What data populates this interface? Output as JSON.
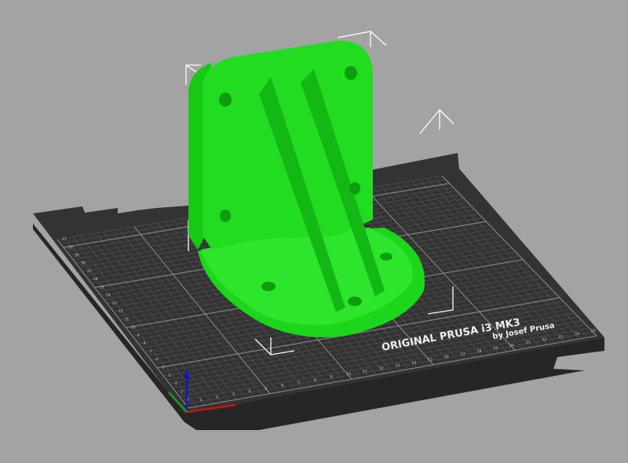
{
  "viewport": {
    "background_color": "#a3a3a3",
    "bed": {
      "logo_line1": "ORIGINAL PRUSA i3  MK3",
      "logo_line2": "by Josef Prusa",
      "surface_color": "#333333",
      "grid_color": "#6a6a6a",
      "axis_labels_x": [
        "1",
        "2",
        "3",
        "4",
        "5",
        "6",
        "7",
        "8",
        "9",
        "10",
        "11",
        "12",
        "13",
        "14",
        "15",
        "16",
        "17",
        "18",
        "19",
        "20",
        "21",
        "22",
        "23",
        "24",
        "25"
      ],
      "axis_labels_y": [
        "1",
        "2",
        "3",
        "4",
        "5",
        "6",
        "7",
        "8",
        "9",
        "10",
        "11",
        "12",
        "13",
        "14",
        "15",
        "16",
        "17",
        "18",
        "19",
        "20",
        "21"
      ]
    },
    "model": {
      "color": "#1ee01e",
      "selected": true
    },
    "axes": {
      "x_color": "#cc1111",
      "y_color": "#11aa11",
      "z_color": "#1111cc"
    }
  }
}
